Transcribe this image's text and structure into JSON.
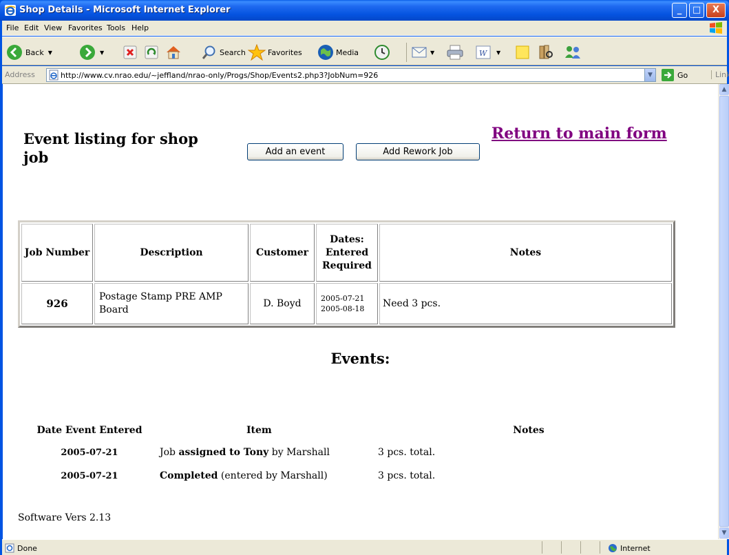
{
  "window": {
    "title": "Shop Details - Microsoft Internet Explorer",
    "minimize": "_",
    "maximize": "□",
    "close": "X"
  },
  "menu": {
    "items": [
      "File",
      "Edit",
      "View",
      "Favorites",
      "Tools",
      "Help"
    ]
  },
  "toolbar": {
    "back_label": "Back",
    "search_label": "Search",
    "favorites_label": "Favorites",
    "media_label": "Media"
  },
  "address": {
    "label": "Address",
    "url": "http://www.cv.nrao.edu/~jeffland/nrao-only/Progs/Shop/Events2.php3?JobNum=926",
    "go_label": "Go",
    "links_label": "Links"
  },
  "page": {
    "heading": "Event listing for shop job",
    "add_event_label": "Add an event",
    "add_rework_label": "Add Rework Job",
    "return_link": "Return to main form",
    "job_table": {
      "headers": {
        "job_number": "Job Number",
        "description": "Description",
        "customer": "Customer",
        "dates_line1": "Dates:",
        "dates_line2": "Entered",
        "dates_line3": "Required",
        "notes": "Notes"
      },
      "row": {
        "job_number": "926",
        "description": "Postage Stamp PRE AMP Board",
        "customer": "D. Boyd",
        "date_entered": "2005-07-21",
        "date_required": "2005-08-18",
        "notes": "Need 3 pcs."
      }
    },
    "events_title": "Events:",
    "events_table": {
      "headers": {
        "date": "Date Event Entered",
        "item": "Item",
        "notes": "Notes"
      },
      "rows": [
        {
          "date": "2005-07-21",
          "item_pre": "Job ",
          "item_bold": "assigned to Tony",
          "item_post": " by Marshall",
          "notes": "3 pcs. total."
        },
        {
          "date": "2005-07-21",
          "item_pre": "",
          "item_bold": "Completed",
          "item_post": " (entered by Marshall)",
          "notes": "3 pcs. total."
        }
      ]
    },
    "version": "Software Vers 2.13"
  },
  "status": {
    "text": "Done",
    "zone": "Internet"
  },
  "colors": {
    "titlebar": "#0054E3",
    "visited_link": "#800080",
    "chrome": "#ECE9D8"
  }
}
